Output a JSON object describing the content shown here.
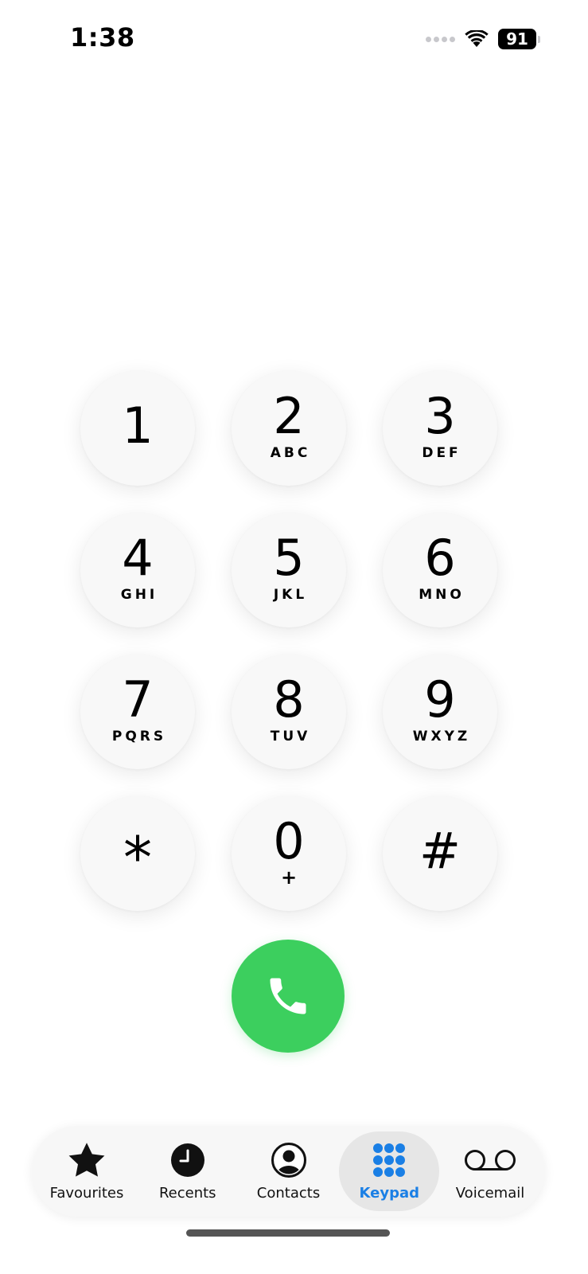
{
  "status_bar": {
    "time": "1:38",
    "battery_level": "91"
  },
  "keypad": {
    "keys": [
      {
        "digit": "1",
        "letters": ""
      },
      {
        "digit": "2",
        "letters": "ABC"
      },
      {
        "digit": "3",
        "letters": "DEF"
      },
      {
        "digit": "4",
        "letters": "GHI"
      },
      {
        "digit": "5",
        "letters": "JKL"
      },
      {
        "digit": "6",
        "letters": "MNO"
      },
      {
        "digit": "7",
        "letters": "PQRS"
      },
      {
        "digit": "8",
        "letters": "TUV"
      },
      {
        "digit": "9",
        "letters": "WXYZ"
      },
      {
        "digit": "*",
        "letters": ""
      },
      {
        "digit": "0",
        "letters": "+"
      },
      {
        "digit": "#",
        "letters": ""
      }
    ]
  },
  "call_button": {
    "icon": "phone-icon",
    "color": "#3ccf5e"
  },
  "tab_bar": {
    "active_color": "#1a7fe5",
    "tabs": [
      {
        "label": "Favourites",
        "icon": "star-icon",
        "active": false
      },
      {
        "label": "Recents",
        "icon": "clock-icon",
        "active": false
      },
      {
        "label": "Contacts",
        "icon": "person-icon",
        "active": false
      },
      {
        "label": "Keypad",
        "icon": "keypad-icon",
        "active": true
      },
      {
        "label": "Voicemail",
        "icon": "voicemail-icon",
        "active": false
      }
    ]
  }
}
